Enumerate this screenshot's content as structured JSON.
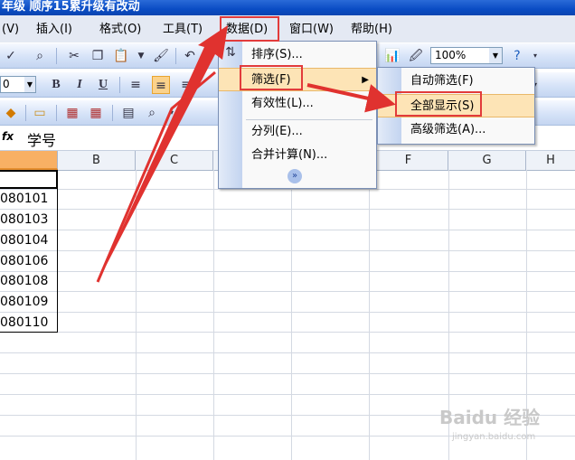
{
  "window": {
    "title": "年级 顺序15累升级有改动"
  },
  "menubar": {
    "items": [
      {
        "label": "(V)"
      },
      {
        "label": "插入(I)"
      },
      {
        "label": "格式(O)"
      },
      {
        "label": "工具(T)"
      },
      {
        "label": "数据(D)"
      },
      {
        "label": "窗口(W)"
      },
      {
        "label": "帮助(H)"
      }
    ]
  },
  "toolbar": {
    "zoom": "100%",
    "font_size": "0",
    "bold": "B",
    "italic": "I",
    "underline": "U"
  },
  "formula_bar": {
    "fx": "fx",
    "content": "学号"
  },
  "columns": [
    "B",
    "C",
    "F",
    "G",
    "H"
  ],
  "cells": [
    "080101",
    "080103",
    "080104",
    "080106",
    "080108",
    "080109",
    "080110"
  ],
  "data_menu": {
    "items": [
      {
        "label": "排序(S)..."
      },
      {
        "label": "筛选(F)"
      },
      {
        "label": "有效性(L)..."
      },
      {
        "label": "分列(E)..."
      },
      {
        "label": "合并计算(N)..."
      }
    ]
  },
  "filter_submenu": {
    "items": [
      {
        "label": "自动筛选(F)"
      },
      {
        "label": "全部显示(S)"
      },
      {
        "label": "高级筛选(A)..."
      }
    ]
  },
  "watermark": {
    "text": "Baidu 经验",
    "url": "jingyan.baidu.com"
  }
}
